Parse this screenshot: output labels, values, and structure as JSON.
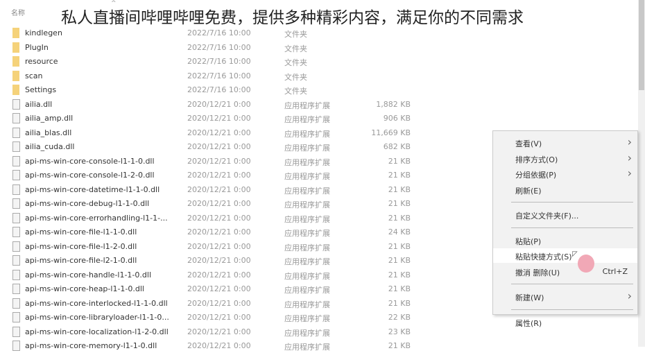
{
  "overlay_title": "私人直播间哔哩哔哩免费，提供多种精彩内容，满足你的不同需求",
  "header": {
    "name_col": "名称",
    "sort_icon": "^"
  },
  "files": [
    {
      "name": "kindlegen",
      "date": "2022/7/16 10:00",
      "type": "文件夹",
      "size": "",
      "icon": "folder-icon"
    },
    {
      "name": "PlugIn",
      "date": "2022/7/16 10:00",
      "type": "文件夹",
      "size": "",
      "icon": "folder-icon"
    },
    {
      "name": "resource",
      "date": "2022/7/16 10:00",
      "type": "文件夹",
      "size": "",
      "icon": "folder-icon"
    },
    {
      "name": "scan",
      "date": "2022/7/16 10:00",
      "type": "文件夹",
      "size": "",
      "icon": "folder-icon"
    },
    {
      "name": "Settings",
      "date": "2022/7/16 10:00",
      "type": "文件夹",
      "size": "",
      "icon": "folder-icon"
    },
    {
      "name": "ailia.dll",
      "date": "2020/12/21 0:00",
      "type": "应用程序扩展",
      "size": "1,882 KB",
      "icon": "dll-file-icon"
    },
    {
      "name": "ailia_amp.dll",
      "date": "2020/12/21 0:00",
      "type": "应用程序扩展",
      "size": "906 KB",
      "icon": "dll-file-icon"
    },
    {
      "name": "ailia_blas.dll",
      "date": "2020/12/21 0:00",
      "type": "应用程序扩展",
      "size": "11,669 KB",
      "icon": "dll-file-icon"
    },
    {
      "name": "ailia_cuda.dll",
      "date": "2020/12/21 0:00",
      "type": "应用程序扩展",
      "size": "682 KB",
      "icon": "dll-file-icon"
    },
    {
      "name": "api-ms-win-core-console-l1-1-0.dll",
      "date": "2020/12/21 0:00",
      "type": "应用程序扩展",
      "size": "21 KB",
      "icon": "dll-file-icon"
    },
    {
      "name": "api-ms-win-core-console-l1-2-0.dll",
      "date": "2020/12/21 0:00",
      "type": "应用程序扩展",
      "size": "21 KB",
      "icon": "dll-file-icon"
    },
    {
      "name": "api-ms-win-core-datetime-l1-1-0.dll",
      "date": "2020/12/21 0:00",
      "type": "应用程序扩展",
      "size": "21 KB",
      "icon": "dll-file-icon"
    },
    {
      "name": "api-ms-win-core-debug-l1-1-0.dll",
      "date": "2020/12/21 0:00",
      "type": "应用程序扩展",
      "size": "21 KB",
      "icon": "dll-file-icon"
    },
    {
      "name": "api-ms-win-core-errorhandling-l1-1-...",
      "date": "2020/12/21 0:00",
      "type": "应用程序扩展",
      "size": "21 KB",
      "icon": "dll-file-icon"
    },
    {
      "name": "api-ms-win-core-file-l1-1-0.dll",
      "date": "2020/12/21 0:00",
      "type": "应用程序扩展",
      "size": "24 KB",
      "icon": "dll-file-icon"
    },
    {
      "name": "api-ms-win-core-file-l1-2-0.dll",
      "date": "2020/12/21 0:00",
      "type": "应用程序扩展",
      "size": "21 KB",
      "icon": "dll-file-icon"
    },
    {
      "name": "api-ms-win-core-file-l2-1-0.dll",
      "date": "2020/12/21 0:00",
      "type": "应用程序扩展",
      "size": "21 KB",
      "icon": "dll-file-icon"
    },
    {
      "name": "api-ms-win-core-handle-l1-1-0.dll",
      "date": "2020/12/21 0:00",
      "type": "应用程序扩展",
      "size": "21 KB",
      "icon": "dll-file-icon"
    },
    {
      "name": "api-ms-win-core-heap-l1-1-0.dll",
      "date": "2020/12/21 0:00",
      "type": "应用程序扩展",
      "size": "21 KB",
      "icon": "dll-file-icon"
    },
    {
      "name": "api-ms-win-core-interlocked-l1-1-0.dll",
      "date": "2020/12/21 0:00",
      "type": "应用程序扩展",
      "size": "21 KB",
      "icon": "dll-file-icon"
    },
    {
      "name": "api-ms-win-core-libraryloader-l1-1-0...",
      "date": "2020/12/21 0:00",
      "type": "应用程序扩展",
      "size": "22 KB",
      "icon": "dll-file-icon"
    },
    {
      "name": "api-ms-win-core-localization-l1-2-0.dll",
      "date": "2020/12/21 0:00",
      "type": "应用程序扩展",
      "size": "23 KB",
      "icon": "dll-file-icon"
    },
    {
      "name": "api-ms-win-core-memory-l1-1-0.dll",
      "date": "2020/12/21 0:00",
      "type": "应用程序扩展",
      "size": "21 KB",
      "icon": "dll-file-icon"
    }
  ],
  "context_menu": [
    {
      "label": "查看(V)",
      "submenu": true
    },
    {
      "label": "排序方式(O)",
      "submenu": true
    },
    {
      "label": "分组依据(P)",
      "submenu": true
    },
    {
      "label": "刷新(E)"
    },
    {
      "separator": true
    },
    {
      "label": "自定义文件夹(F)..."
    },
    {
      "separator": true
    },
    {
      "label": "粘贴(P)"
    },
    {
      "label": "粘贴快捷方式(S)",
      "highlighted": true
    },
    {
      "label": "撤消 删除(U)",
      "shortcut": "Ctrl+Z"
    },
    {
      "separator": true
    },
    {
      "label": "新建(W)",
      "submenu": true
    },
    {
      "separator": true
    },
    {
      "label": "属性(R)"
    }
  ]
}
